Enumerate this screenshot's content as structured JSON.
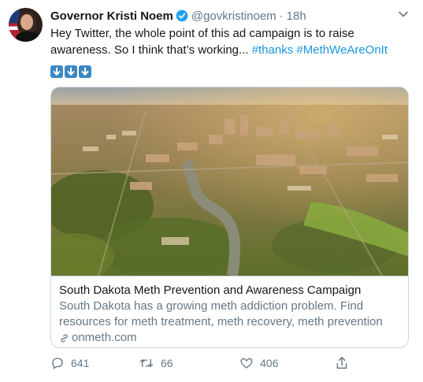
{
  "tweet": {
    "display_name": "Governor Kristi Noem",
    "handle": "@govkristinoem",
    "separator": "·",
    "time": "18h",
    "text_plain": "Hey Twitter, the whole point of this ad campaign is to raise awareness. So I think that’s working... ",
    "hashtags": [
      "#thanks",
      "#MethWeAreOnIt"
    ],
    "emojis": [
      "down-arrow-emoji",
      "down-arrow-emoji",
      "down-arrow-emoji"
    ]
  },
  "card": {
    "title": "South Dakota Meth Prevention and Awareness Campaign",
    "description": "South Dakota has a growing meth addiction problem. Find resources for meth treatment, meth recovery, meth prevention tips, advocacy ...",
    "domain": "onmeth.com"
  },
  "actions": {
    "replies": "641",
    "retweets": "66",
    "likes": "406"
  },
  "colors": {
    "link": "#1b95e0",
    "muted": "#657786",
    "text": "#14171a",
    "verified": "#1da1f2"
  }
}
